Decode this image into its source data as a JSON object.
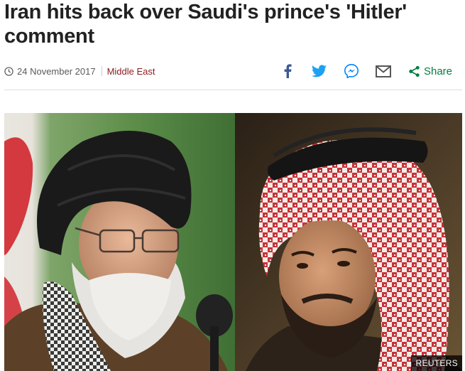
{
  "article": {
    "headline": "Iran hits back over Saudi's prince's 'Hitler' comment",
    "date": "24 November 2017",
    "section": "Middle East"
  },
  "share": {
    "facebook_icon": "facebook-icon",
    "twitter_icon": "twitter-icon",
    "messenger_icon": "messenger-icon",
    "email_icon": "email-icon",
    "share_icon": "share-icon",
    "share_label": "Share"
  },
  "image": {
    "credit": "REUTERS"
  },
  "colors": {
    "section_link": "#8a1c1c",
    "share_green": "#007f3f",
    "facebook_blue": "#3b5998",
    "twitter_blue": "#1da1f2",
    "messenger_blue": "#0084ff"
  }
}
